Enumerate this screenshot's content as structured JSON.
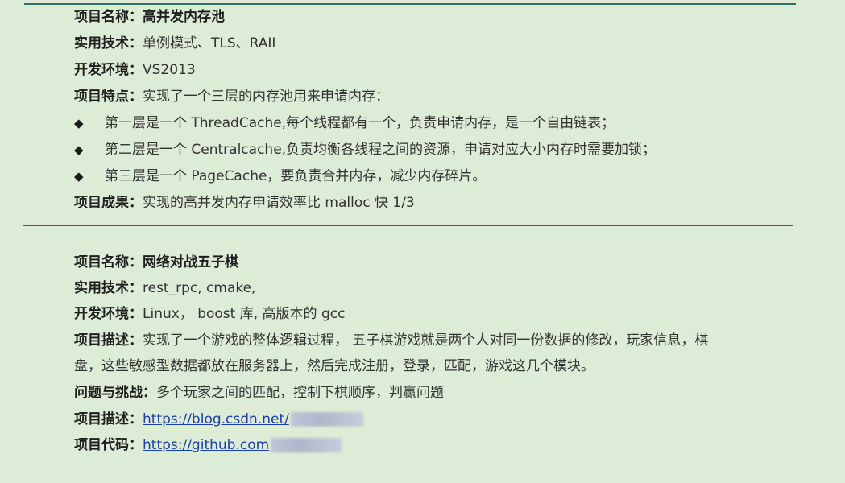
{
  "project1": {
    "name_label": "项目名称：",
    "name_value": "高并发内存池",
    "tech_label": "实用技术：",
    "tech_value": "单例模式、TLS、RAII",
    "env_label": "开发环境：",
    "env_value": "VS2013",
    "feature_label": "项目特点：",
    "feature_value": "实现了一个三层的内存池用来申请内存：",
    "bullet_icon": "diamond-bullet",
    "bullets": [
      "第一层是一个 ThreadCache,每个线程都有一个，负责申请内存，是一个自由链表；",
      "第二层是一个 Centralcache,负责均衡各线程之间的资源，申请对应大小内存时需要加锁；",
      "第三层是一个 PageCache，要负责合并内存，减少内存碎片。"
    ],
    "result_label": "项目成果：",
    "result_value": "实现的高并发内存申请效率比 malloc 快 1/3"
  },
  "project2": {
    "name_label": "项目名称：",
    "name_value": "网络对战五子棋",
    "tech_label": "实用技术：",
    "tech_value": "rest_rpc, cmake,",
    "env_label": "开发环境：",
    "env_value": "Linux， boost 库, 高版本的 gcc",
    "desc_label": "项目描述：",
    "desc_value_line1": "实现了一个游戏的整体逻辑过程， 五子棋游戏就是两个人对同一份数据的修改，玩家信息，棋",
    "desc_value_line2": "盘，这些敏感型数据都放在服务器上，然后完成注册，登录，匹配，游戏这几个模块。",
    "challenge_label": "问题与挑战：",
    "challenge_value": "多个玩家之间的匹配，控制下棋顺序，判赢问题",
    "blog_label": "项目描述：",
    "blog_link": "https://blog.csdn.net/",
    "code_label": "项目代码：",
    "code_link": "https://github.com"
  }
}
